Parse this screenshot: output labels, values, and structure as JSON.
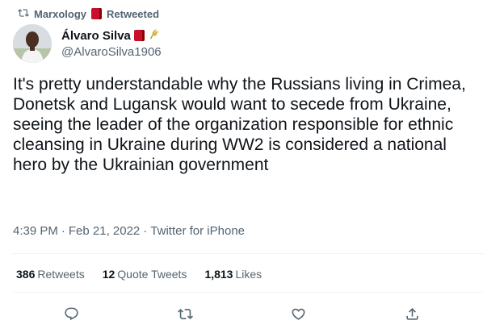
{
  "retweet_banner": {
    "retweeter": "Marxology",
    "status": "Retweeted"
  },
  "author": {
    "name": "Álvaro Silva",
    "handle": "@AlvaroSilva1906"
  },
  "tweet": {
    "text": "It's pretty understandable why the Russians living in Crimea, Donetsk and Lugansk would want to secede from Ukraine, seeing the leader of the organization responsible for ethnic cleansing in Ukraine during WW2 is considered a national hero by the Ukrainian government"
  },
  "meta": {
    "time": "4:39 PM",
    "date": "Feb 21, 2022",
    "separator1": "·",
    "separator2": "·",
    "source": "Twitter for iPhone"
  },
  "stats": {
    "retweets_count": "386",
    "retweets_label": "Retweets",
    "quotes_count": "12",
    "quotes_label": "Quote Tweets",
    "likes_count": "1,813",
    "likes_label": "Likes"
  },
  "icons": {
    "retweet_banner": "retweet-icon",
    "book_emoji": "red-book-emoji",
    "wheat_emoji": "wheat-emoji",
    "reply": "reply-icon",
    "retweet": "retweet-icon",
    "like": "heart-icon",
    "share": "share-icon"
  },
  "colors": {
    "text_primary": "#0f1419",
    "text_secondary": "#536471",
    "divider": "#eff3f4"
  }
}
